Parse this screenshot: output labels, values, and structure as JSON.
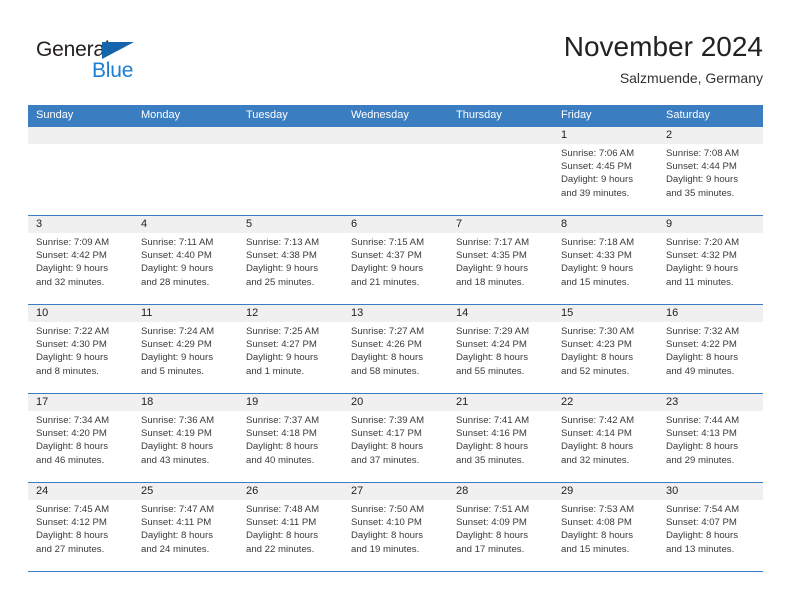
{
  "brand": {
    "name_top": "General",
    "name_bottom": "Blue",
    "accent_color": "#1b7fd4",
    "triangle_color": "#1664ab"
  },
  "header": {
    "title": "November 2024",
    "subtitle": "Salzmuende, Germany",
    "header_bg": "#3a7dc0",
    "daynum_bg": "#f0f0f0"
  },
  "weekdays": [
    "Sunday",
    "Monday",
    "Tuesday",
    "Wednesday",
    "Thursday",
    "Friday",
    "Saturday"
  ],
  "weeks": [
    [
      {
        "day": "",
        "lines": []
      },
      {
        "day": "",
        "lines": []
      },
      {
        "day": "",
        "lines": []
      },
      {
        "day": "",
        "lines": []
      },
      {
        "day": "",
        "lines": []
      },
      {
        "day": "1",
        "lines": [
          "Sunrise: 7:06 AM",
          "Sunset: 4:45 PM",
          "Daylight: 9 hours",
          "and 39 minutes."
        ]
      },
      {
        "day": "2",
        "lines": [
          "Sunrise: 7:08 AM",
          "Sunset: 4:44 PM",
          "Daylight: 9 hours",
          "and 35 minutes."
        ]
      }
    ],
    [
      {
        "day": "3",
        "lines": [
          "Sunrise: 7:09 AM",
          "Sunset: 4:42 PM",
          "Daylight: 9 hours",
          "and 32 minutes."
        ]
      },
      {
        "day": "4",
        "lines": [
          "Sunrise: 7:11 AM",
          "Sunset: 4:40 PM",
          "Daylight: 9 hours",
          "and 28 minutes."
        ]
      },
      {
        "day": "5",
        "lines": [
          "Sunrise: 7:13 AM",
          "Sunset: 4:38 PM",
          "Daylight: 9 hours",
          "and 25 minutes."
        ]
      },
      {
        "day": "6",
        "lines": [
          "Sunrise: 7:15 AM",
          "Sunset: 4:37 PM",
          "Daylight: 9 hours",
          "and 21 minutes."
        ]
      },
      {
        "day": "7",
        "lines": [
          "Sunrise: 7:17 AM",
          "Sunset: 4:35 PM",
          "Daylight: 9 hours",
          "and 18 minutes."
        ]
      },
      {
        "day": "8",
        "lines": [
          "Sunrise: 7:18 AM",
          "Sunset: 4:33 PM",
          "Daylight: 9 hours",
          "and 15 minutes."
        ]
      },
      {
        "day": "9",
        "lines": [
          "Sunrise: 7:20 AM",
          "Sunset: 4:32 PM",
          "Daylight: 9 hours",
          "and 11 minutes."
        ]
      }
    ],
    [
      {
        "day": "10",
        "lines": [
          "Sunrise: 7:22 AM",
          "Sunset: 4:30 PM",
          "Daylight: 9 hours",
          "and 8 minutes."
        ]
      },
      {
        "day": "11",
        "lines": [
          "Sunrise: 7:24 AM",
          "Sunset: 4:29 PM",
          "Daylight: 9 hours",
          "and 5 minutes."
        ]
      },
      {
        "day": "12",
        "lines": [
          "Sunrise: 7:25 AM",
          "Sunset: 4:27 PM",
          "Daylight: 9 hours",
          "and 1 minute."
        ]
      },
      {
        "day": "13",
        "lines": [
          "Sunrise: 7:27 AM",
          "Sunset: 4:26 PM",
          "Daylight: 8 hours",
          "and 58 minutes."
        ]
      },
      {
        "day": "14",
        "lines": [
          "Sunrise: 7:29 AM",
          "Sunset: 4:24 PM",
          "Daylight: 8 hours",
          "and 55 minutes."
        ]
      },
      {
        "day": "15",
        "lines": [
          "Sunrise: 7:30 AM",
          "Sunset: 4:23 PM",
          "Daylight: 8 hours",
          "and 52 minutes."
        ]
      },
      {
        "day": "16",
        "lines": [
          "Sunrise: 7:32 AM",
          "Sunset: 4:22 PM",
          "Daylight: 8 hours",
          "and 49 minutes."
        ]
      }
    ],
    [
      {
        "day": "17",
        "lines": [
          "Sunrise: 7:34 AM",
          "Sunset: 4:20 PM",
          "Daylight: 8 hours",
          "and 46 minutes."
        ]
      },
      {
        "day": "18",
        "lines": [
          "Sunrise: 7:36 AM",
          "Sunset: 4:19 PM",
          "Daylight: 8 hours",
          "and 43 minutes."
        ]
      },
      {
        "day": "19",
        "lines": [
          "Sunrise: 7:37 AM",
          "Sunset: 4:18 PM",
          "Daylight: 8 hours",
          "and 40 minutes."
        ]
      },
      {
        "day": "20",
        "lines": [
          "Sunrise: 7:39 AM",
          "Sunset: 4:17 PM",
          "Daylight: 8 hours",
          "and 37 minutes."
        ]
      },
      {
        "day": "21",
        "lines": [
          "Sunrise: 7:41 AM",
          "Sunset: 4:16 PM",
          "Daylight: 8 hours",
          "and 35 minutes."
        ]
      },
      {
        "day": "22",
        "lines": [
          "Sunrise: 7:42 AM",
          "Sunset: 4:14 PM",
          "Daylight: 8 hours",
          "and 32 minutes."
        ]
      },
      {
        "day": "23",
        "lines": [
          "Sunrise: 7:44 AM",
          "Sunset: 4:13 PM",
          "Daylight: 8 hours",
          "and 29 minutes."
        ]
      }
    ],
    [
      {
        "day": "24",
        "lines": [
          "Sunrise: 7:45 AM",
          "Sunset: 4:12 PM",
          "Daylight: 8 hours",
          "and 27 minutes."
        ]
      },
      {
        "day": "25",
        "lines": [
          "Sunrise: 7:47 AM",
          "Sunset: 4:11 PM",
          "Daylight: 8 hours",
          "and 24 minutes."
        ]
      },
      {
        "day": "26",
        "lines": [
          "Sunrise: 7:48 AM",
          "Sunset: 4:11 PM",
          "Daylight: 8 hours",
          "and 22 minutes."
        ]
      },
      {
        "day": "27",
        "lines": [
          "Sunrise: 7:50 AM",
          "Sunset: 4:10 PM",
          "Daylight: 8 hours",
          "and 19 minutes."
        ]
      },
      {
        "day": "28",
        "lines": [
          "Sunrise: 7:51 AM",
          "Sunset: 4:09 PM",
          "Daylight: 8 hours",
          "and 17 minutes."
        ]
      },
      {
        "day": "29",
        "lines": [
          "Sunrise: 7:53 AM",
          "Sunset: 4:08 PM",
          "Daylight: 8 hours",
          "and 15 minutes."
        ]
      },
      {
        "day": "30",
        "lines": [
          "Sunrise: 7:54 AM",
          "Sunset: 4:07 PM",
          "Daylight: 8 hours",
          "and 13 minutes."
        ]
      }
    ]
  ]
}
